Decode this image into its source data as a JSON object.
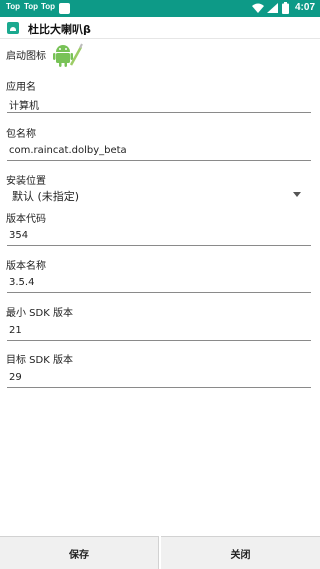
{
  "status_bar": {
    "notifications": [
      "Top",
      "Top",
      "Top"
    ],
    "time": "4:07",
    "background_color": "#0d9a87"
  },
  "title_bar": {
    "title": "杜比大喇叭β",
    "icon": "app-icon"
  },
  "form": {
    "icon_label": "启动图标",
    "icon_name": "android-icon",
    "app_name_label": "应用名",
    "app_name_value": "计算机",
    "package_label": "包名称",
    "package_value": "com.raincat.dolby_beta",
    "install_location_label": "安装位置",
    "install_location_value": "默认 (未指定)",
    "version_code_label": "版本代码",
    "version_code_value": "354",
    "version_name_label": "版本名称",
    "version_name_value": "3.5.4",
    "min_sdk_label": "最小 SDK 版本",
    "min_sdk_value": "21",
    "target_sdk_label": "目标 SDK 版本",
    "target_sdk_value": "29"
  },
  "buttons": {
    "save": "保存",
    "close": "关闭"
  },
  "colors": {
    "accent": "#0d9a87",
    "android_green": "#78c257"
  }
}
